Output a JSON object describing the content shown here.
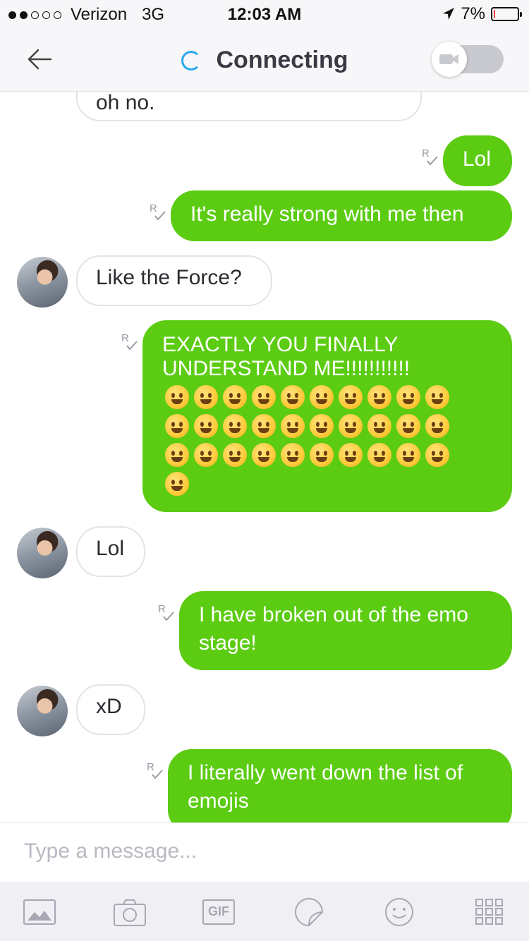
{
  "status_bar": {
    "signal_filled": 2,
    "signal_total": 5,
    "carrier": "Verizon",
    "network": "3G",
    "time": "12:03 AM",
    "battery_percent_label": "7%",
    "battery_level": 0.07,
    "location_icon": "location-arrow-icon"
  },
  "header": {
    "back_icon": "back-arrow-icon",
    "title": "Connecting",
    "status_icon": "spinner-icon",
    "video_toggle_icon": "video-camera-icon",
    "video_enabled": false
  },
  "conversation": {
    "messages": [
      {
        "direction": "incoming",
        "text": "oh no."
      },
      {
        "direction": "outgoing",
        "text": "Lol",
        "receipt": "R"
      },
      {
        "direction": "outgoing",
        "text": "It's really strong with me then",
        "receipt": "R"
      },
      {
        "direction": "incoming",
        "text": "Like the Force?",
        "avatar": true
      },
      {
        "direction": "outgoing",
        "text": "EXACTLY YOU FINALLY UNDERSTAND ME!!!!!!!!!!!",
        "emoji_count": 31,
        "receipt": "R"
      },
      {
        "direction": "incoming",
        "text": "Lol",
        "avatar": true
      },
      {
        "direction": "outgoing",
        "text": "I have broken out of the emo stage!",
        "receipt": "R"
      },
      {
        "direction": "incoming",
        "text": "xD",
        "avatar": true
      },
      {
        "direction": "outgoing",
        "text": "I literally went down the list of emojis",
        "receipt": "R"
      }
    ]
  },
  "input": {
    "placeholder": "Type a message..."
  },
  "toolbar": {
    "items": [
      {
        "name": "photo-gallery-icon"
      },
      {
        "name": "camera-icon"
      },
      {
        "name": "gif-icon",
        "label": "GIF"
      },
      {
        "name": "sticker-icon"
      },
      {
        "name": "emoji-icon"
      },
      {
        "name": "more-apps-grid-icon"
      }
    ]
  },
  "colors": {
    "outgoing_bubble": "#5ccc13",
    "incoming_border": "#e3e3e8",
    "spinner": "#2aa7f0",
    "battery_low": "#ff3b30"
  }
}
